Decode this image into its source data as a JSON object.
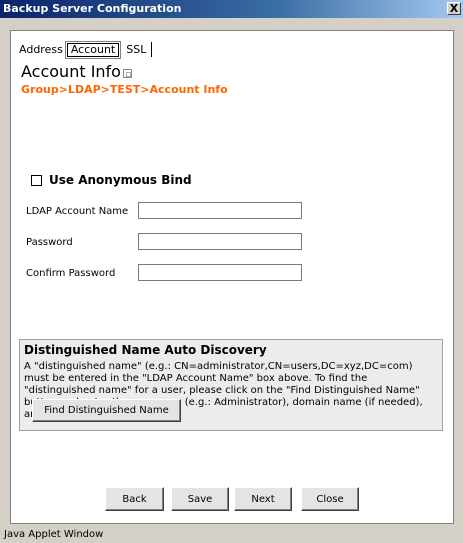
{
  "window": {
    "title": "Backup Server Configuration",
    "close_glyph": "X"
  },
  "tabs": [
    {
      "label": "Address",
      "selected": false
    },
    {
      "label": "Account",
      "selected": true
    },
    {
      "label": "SSL",
      "selected": false
    }
  ],
  "page": {
    "heading": "Account Info",
    "breadcrumb": "Group>LDAP>TEST>Account Info",
    "breadcrumb_color": "#ff6600"
  },
  "anonymous_bind": {
    "label": "Use Anonymous Bind",
    "checked": false
  },
  "fields": [
    {
      "label": "LDAP Account Name",
      "value": ""
    },
    {
      "label": "Password",
      "value": ""
    },
    {
      "label": "Confirm Password",
      "value": ""
    }
  ],
  "dn_discovery": {
    "title": "Distinguished Name Auto Discovery",
    "description": "A \"distinguished name\" (e.g.: CN=administrator,CN=users,DC=xyz,DC=com) must be entered in the \"LDAP Account Name\" box above. To find the \"distinguished name\" for a user, please click on the \"Find Distinguished Name\" button and enter the username (e.g.: Administrator), domain name (if needed), and password.",
    "button_label": "Find Distinguished Name"
  },
  "actions": {
    "back": "Back",
    "save": "Save",
    "next": "Next",
    "close": "Close"
  },
  "footer": {
    "status": "Java Applet Window"
  }
}
